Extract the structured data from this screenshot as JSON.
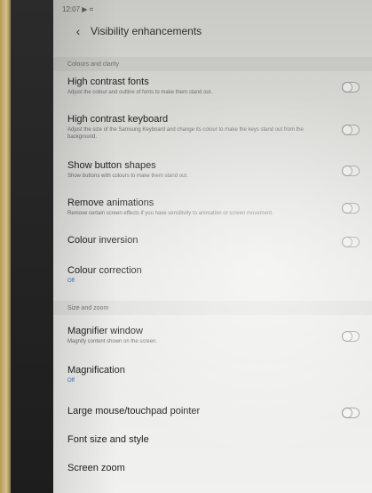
{
  "statusbar": {
    "time": "12:07 ▶ ⌗"
  },
  "header": {
    "title": "Visibility enhancements"
  },
  "sections": [
    {
      "title": "Colours and clarity",
      "items": [
        {
          "label": "High contrast fonts",
          "desc": "Adjust the colour and outline of fonts to make them stand out.",
          "toggle": false
        },
        {
          "label": "High contrast keyboard",
          "desc": "Adjust the size of the Samsung Keyboard and change its colour to make the keys stand out from the background.",
          "toggle": false
        },
        {
          "label": "Show button shapes",
          "desc": "Show buttons with colours to make them stand out.",
          "toggle": false
        },
        {
          "label": "Remove animations",
          "desc": "Remove certain screen effects if you have sensitivity to animation or screen movement.",
          "toggle": false
        },
        {
          "label": "Colour inversion",
          "desc": "",
          "toggle": false
        },
        {
          "label": "Colour correction",
          "sub": "Off"
        }
      ]
    },
    {
      "title": "Size and zoom",
      "items": [
        {
          "label": "Magnifier window",
          "desc": "Magnify content shown on the screen.",
          "toggle": false
        },
        {
          "label": "Magnification",
          "sub": "Off"
        },
        {
          "label": "Large mouse/touchpad pointer",
          "desc": "",
          "toggle": false
        },
        {
          "label": "Font size and style"
        },
        {
          "label": "Screen zoom"
        }
      ]
    }
  ]
}
